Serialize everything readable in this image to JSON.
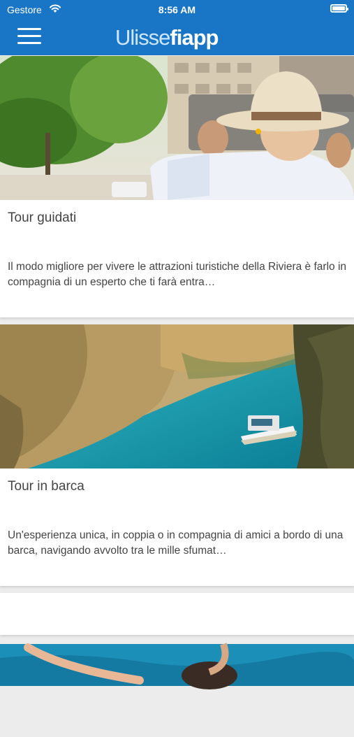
{
  "status_bar": {
    "carrier": "Gestore",
    "time": "8:56 AM"
  },
  "header": {
    "logo_part1": "Ulisse",
    "logo_part2": "fiapp",
    "menu_icon": "hamburger-menu-icon"
  },
  "cards": [
    {
      "title": "Tour guidati",
      "description": "Il modo migliore per vivere le attrazioni turistiche della Riviera è farlo in compagnia di un esperto che ti farà entra…",
      "image": "tourists-on-open-top-bus"
    },
    {
      "title": "Tour in barca",
      "description": "Un'esperienza unica, in coppia o in compagnia di amici a bordo di una barca, navigando avvolto tra le mille sfumat…",
      "image": "boat-in-coastal-gorge"
    },
    {
      "title": "",
      "description": "",
      "image": "swimmer-in-sea"
    }
  ]
}
